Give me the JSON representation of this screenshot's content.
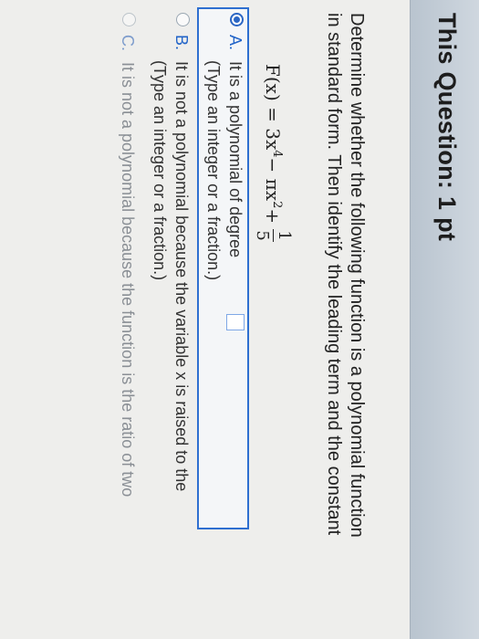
{
  "header": {
    "title": "This Question: 1 pt"
  },
  "question": {
    "prompt_line1": "Determine whether the following function is a polynomial function",
    "prompt_line2": "in standard form. Then identify the leading term and the constant",
    "function_lhs": "F(x) = 3x",
    "exp1": "4",
    "mid": " − πx",
    "exp2": "2",
    "plus": " +",
    "frac_num": "1",
    "frac_den": "5"
  },
  "options": [
    {
      "letter": "A.",
      "text": "It is a polynomial of degree",
      "hint": "(Type an integer or a fraction.)",
      "selected": true
    },
    {
      "letter": "B.",
      "text": "It is not a polynomial because the variable x is raised to the",
      "hint": "(Type an integer or a fraction.)",
      "selected": false
    },
    {
      "letter": "C.",
      "text": "It is not a polynomial because the function is the ratio of two",
      "selected": false
    }
  ],
  "colors": {
    "accent": "#2b66c4",
    "header_bg": "#c3ccd6"
  }
}
